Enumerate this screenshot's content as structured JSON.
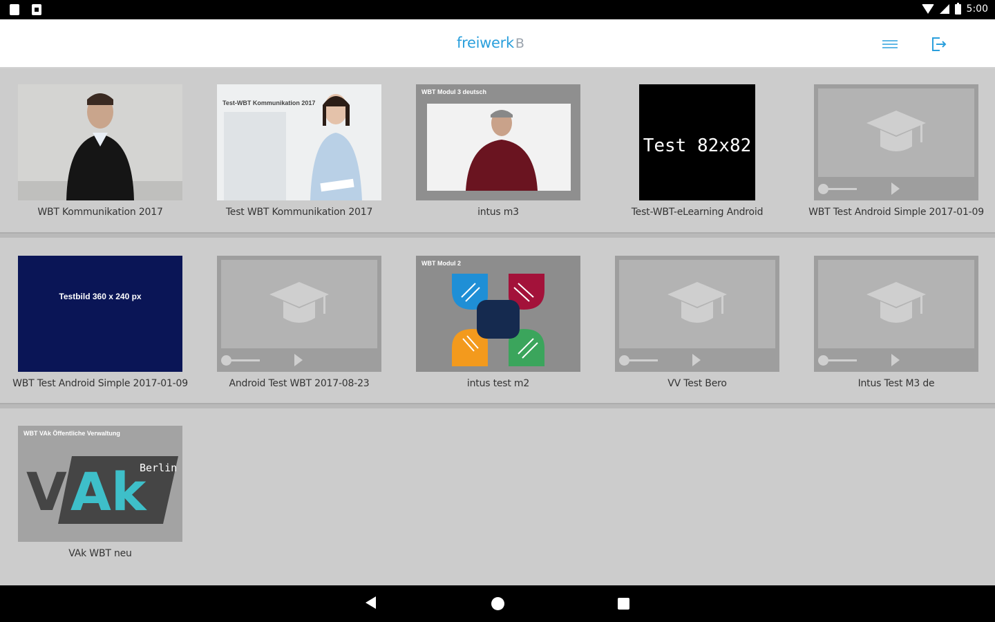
{
  "status_bar": {
    "time": "5:00"
  },
  "app_bar": {
    "logo_text": "freiwerk",
    "logo_mark": "B",
    "accent_color": "#2a9fdc",
    "menu_icon": "menu-icon",
    "logout_icon": "logout-icon"
  },
  "courses": {
    "row1": [
      {
        "title": "WBT Kommunikation 2017"
      },
      {
        "title": "Test WBT Kommunikation 2017",
        "thumb_text": "Test-WBT Kommunikation 2017"
      },
      {
        "title": "intus m3",
        "thumb_text": "WBT Modul 3 deutsch"
      },
      {
        "title": "Test-WBT-eLearning Android",
        "thumb_text": "Test 82x82"
      },
      {
        "title": "WBT Test Android Simple 2017-01-09"
      }
    ],
    "row2": [
      {
        "title": "WBT Test Android Simple 2017-01-09",
        "thumb_text": "Testbild 360 x 240 px"
      },
      {
        "title": "Android Test WBT 2017-08-23"
      },
      {
        "title": "intus test m2",
        "thumb_text": "WBT Modul 2"
      },
      {
        "title": "VV Test Bero"
      },
      {
        "title": "Intus Test M3 de"
      }
    ],
    "row3": [
      {
        "title": "VAk WBT neu",
        "thumb_text": "WBT VAk Öffentliche Verwaltung",
        "logo_text": "VAk",
        "logo_sub": "Berlin"
      }
    ]
  },
  "nav_bar": {
    "back": "back-icon",
    "home": "home-icon",
    "recents": "recents-icon"
  }
}
